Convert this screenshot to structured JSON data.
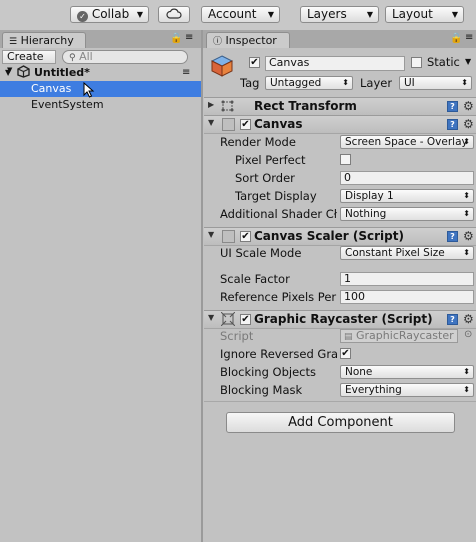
{
  "toolbar": {
    "collab_label": "Collab",
    "cloud_icon": "cloud-icon",
    "account_label": "Account",
    "layers_label": "Layers",
    "layout_label": "Layout"
  },
  "hierarchy": {
    "tab_label": "Hierarchy",
    "create_label": "Create",
    "search_placeholder": "All",
    "scene_name": "Untitled*",
    "items": [
      {
        "label": "Canvas",
        "selected": true
      },
      {
        "label": "EventSystem",
        "selected": false
      }
    ]
  },
  "inspector": {
    "tab_label": "Inspector",
    "object_name": "Canvas",
    "static_label": "Static",
    "tag_label": "Tag",
    "tag_value": "Untagged",
    "layer_label": "Layer",
    "layer_value": "UI",
    "rect_transform": {
      "title": "Rect Transform"
    },
    "canvas": {
      "title": "Canvas",
      "render_mode_label": "Render Mode",
      "render_mode_value": "Screen Space - Overlay",
      "pixel_perfect_label": "Pixel Perfect",
      "sort_order_label": "Sort Order",
      "sort_order_value": "0",
      "target_display_label": "Target Display",
      "target_display_value": "Display 1",
      "additional_shader_label": "Additional Shader Cł",
      "additional_shader_value": "Nothing"
    },
    "canvas_scaler": {
      "title": "Canvas Scaler (Script)",
      "ui_scale_mode_label": "UI Scale Mode",
      "ui_scale_mode_value": "Constant Pixel Size",
      "scale_factor_label": "Scale Factor",
      "scale_factor_value": "1",
      "ref_pixels_label": "Reference Pixels Per",
      "ref_pixels_value": "100"
    },
    "graphic_raycaster": {
      "title": "Graphic Raycaster (Script)",
      "script_label": "Script",
      "script_value": "GraphicRaycaster",
      "ignore_reversed_label": "Ignore Reversed Gra",
      "blocking_objects_label": "Blocking Objects",
      "blocking_objects_value": "None",
      "blocking_mask_label": "Blocking Mask",
      "blocking_mask_value": "Everything"
    },
    "add_component_label": "Add Component"
  },
  "colors": {
    "selection": "#3e7de1",
    "panel": "#c2c2c2",
    "help_icon": "#3f74c0"
  }
}
